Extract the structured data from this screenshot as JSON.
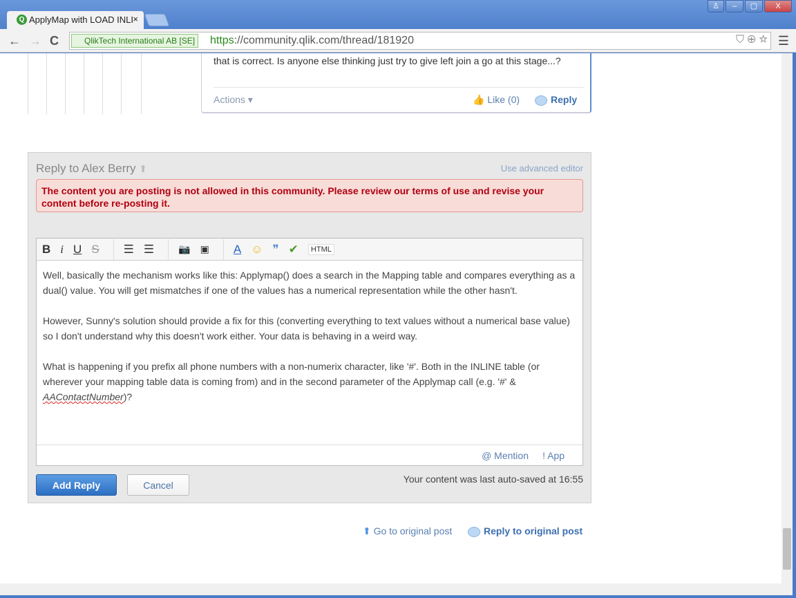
{
  "browser": {
    "tab_title": "ApplyMap with LOAD INLI",
    "tab_close": "×",
    "ev_cert": "QlikTech International AB [SE]",
    "url_scheme": "https",
    "url_rest": "://community.qlik.com/thread/181920",
    "back": "←",
    "forward": "→",
    "reload": "C",
    "menu": "☰",
    "window_buttons": [
      "♙",
      "–",
      "▢",
      "X"
    ]
  },
  "post": {
    "text": "that is correct.  Is anyone else thinking just try to give left join a go at this stage...?",
    "actions": "Actions ▾",
    "like": "Like (0)",
    "reply": "Reply"
  },
  "reply_box": {
    "title": "Reply to Alex Berry",
    "advanced_editor": "Use advanced editor",
    "error": "The content you are posting is not allowed in this community. Please review our terms of use and revise your content before re-posting it.",
    "toolbar": {
      "bold": "B",
      "italic": "i",
      "underline": "U",
      "strike": "S",
      "bullets": "☰",
      "numbers": "☰",
      "image": "📷",
      "video": "▣",
      "font": "A",
      "emoji": "☺",
      "quote": "❞",
      "spell": "✔",
      "html": "HTML"
    },
    "paragraphs": [
      "Well, basically the mechanism works like this: Applymap() does a search in the Mapping table and compares everything as a dual() value. You will get mismatches if one of the values has a numerical representation while the other hasn't.",
      "However, Sunny's solution should provide a fix for this (converting everything to text values without a numerical base value) so I don't understand why this doesn't work either. Your data is behaving in a weird way."
    ],
    "p3_start": "What is happening if you prefix all phone numbers with a non-numerix character, like '#'. Both in the INLINE table (or wherever your mapping table data is coming from) and in the second parameter of the Applymap call (e.g. '#' & ",
    "p3_italic": "AAContactNumber",
    "p3_end": ")?",
    "mention": "@ Mention",
    "app": "! App",
    "add_reply": "Add Reply",
    "cancel": "Cancel",
    "autosaved": "Your content was last auto-saved at 16:55"
  },
  "footer": {
    "go_original": "Go to original post",
    "reply_original": "Reply to original post"
  }
}
